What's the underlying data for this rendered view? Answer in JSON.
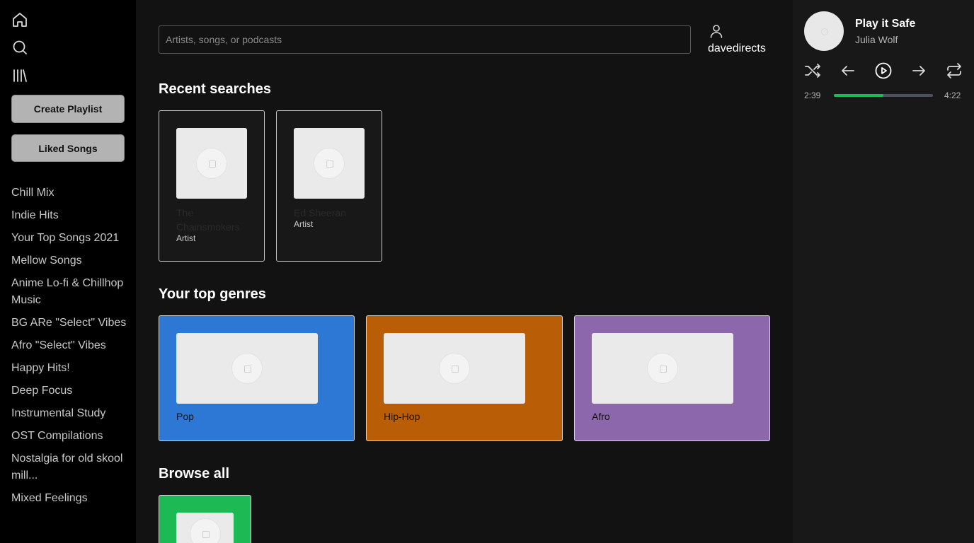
{
  "sidebar": {
    "home_icon": "home-icon",
    "search_icon": "search-icon",
    "library_icon": "library-icon",
    "create_playlist_label": "Create Playlist",
    "liked_songs_label": "Liked Songs",
    "playlists": [
      "Chill Mix",
      "Indie Hits",
      "Your Top Songs 2021",
      "Mellow Songs",
      "Anime Lo-fi & Chillhop Music",
      "BG ARe \"Select\" Vibes",
      "Afro \"Select\" Vibes",
      "Happy Hits!",
      "Deep Focus",
      "Instrumental Study",
      "OST Compilations",
      "Nostalgia for old skool mill...",
      "Mixed Feelings"
    ]
  },
  "main": {
    "search": {
      "placeholder": "Artists, songs, or podcasts",
      "value": ""
    },
    "user": {
      "name": "davedirects",
      "icon": "user-icon"
    },
    "recent": {
      "title": "Recent searches",
      "items": [
        {
          "name": "The Chainsmokers",
          "type": "Artist"
        },
        {
          "name": "Ed Sheeran",
          "type": "Artist"
        }
      ]
    },
    "genres": {
      "title": "Your top genres",
      "items": [
        {
          "name": "Pop",
          "color": "#2d78d5"
        },
        {
          "name": "Hip-Hop",
          "color": "#ba5d07"
        },
        {
          "name": "Afro",
          "color": "#8d67ab"
        }
      ]
    },
    "browse": {
      "title": "Browse all",
      "items": [
        {
          "color": "#1db954"
        }
      ]
    }
  },
  "player": {
    "title": "Play it Safe",
    "artist": "Julia Wolf",
    "elapsed": "2:39",
    "duration": "4:22",
    "progress_fraction": 0.5,
    "accent_color": "#1db954",
    "controls": [
      "shuffle-icon",
      "previous-icon",
      "play-icon",
      "next-icon",
      "repeat-icon"
    ]
  }
}
